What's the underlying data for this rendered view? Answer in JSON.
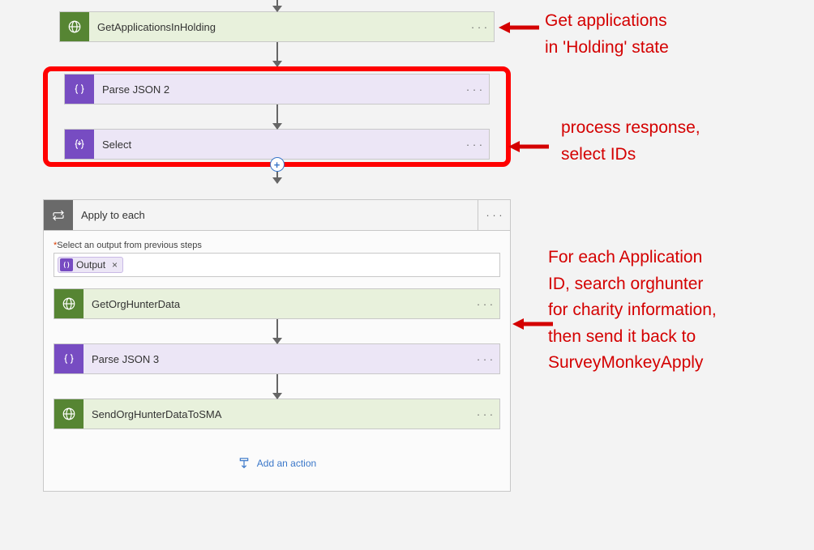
{
  "steps": {
    "getApps": {
      "label": "GetApplicationsInHolding"
    },
    "parse2": {
      "label": "Parse JSON 2"
    },
    "select": {
      "label": "Select"
    },
    "foreach": {
      "header": "Apply to each",
      "inputLabel": "Select an output from previous steps",
      "token": "Output"
    },
    "getOrg": {
      "label": "GetOrgHunterData"
    },
    "parse3": {
      "label": "Parse JSON 3"
    },
    "sendOrg": {
      "label": "SendOrgHunterDataToSMA"
    },
    "addAction": "Add an action"
  },
  "menuDots": "· · ·",
  "annotations": {
    "a1": "Get applications\nin 'Holding' state",
    "a2": "process response,\nselect IDs",
    "a3": "For each Application\nID, search orghunter\nfor charity information,\nthen send it back to\nSurveyMonkeyApply"
  },
  "icons": {
    "globe": "globe-icon",
    "parseJson": "parse-json-icon",
    "select": "select-icon",
    "loop": "loop-icon",
    "addAction": "add-action-icon"
  }
}
